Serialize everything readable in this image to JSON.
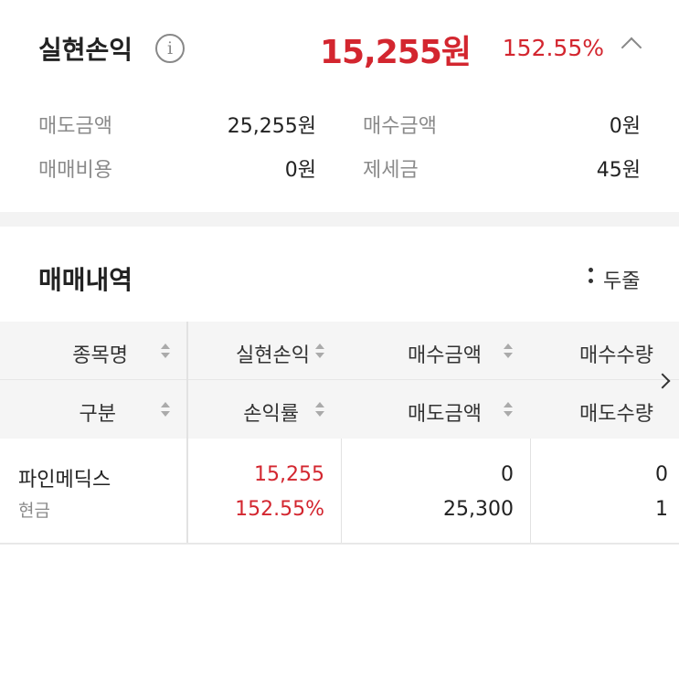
{
  "summary": {
    "title": "실현손익",
    "info_glyph": "i",
    "amount": "15,255원",
    "rate": "152.55%",
    "details": {
      "sell_amount_label": "매도금액",
      "sell_amount_value": "25,255원",
      "buy_amount_label": "매수금액",
      "buy_amount_value": "0원",
      "trade_cost_label": "매매비용",
      "trade_cost_value": "0원",
      "tax_label": "제세금",
      "tax_value": "45원"
    }
  },
  "history": {
    "title": "매매내역",
    "view_toggle_label": "두줄",
    "header": {
      "row1": [
        "종목명",
        "실현손익",
        "매수금액",
        "매수수량"
      ],
      "row2": [
        "구분",
        "손익률",
        "매도금액",
        "매도수량"
      ]
    },
    "rows": [
      {
        "name": "파인메딕스",
        "type": "현금",
        "realized_pl": "15,255",
        "pl_rate": "152.55%",
        "buy_amount": "0",
        "sell_amount": "25,300",
        "buy_qty": "0",
        "sell_qty": "1"
      }
    ]
  },
  "colors": {
    "accent_red": "#d3262f",
    "label_gray": "#8a8a8a",
    "header_bg": "#f5f5f5"
  },
  "icons": [
    "info-icon",
    "chevron-up-icon",
    "more-vertical-icon",
    "sort-icon",
    "chevron-right-icon"
  ]
}
